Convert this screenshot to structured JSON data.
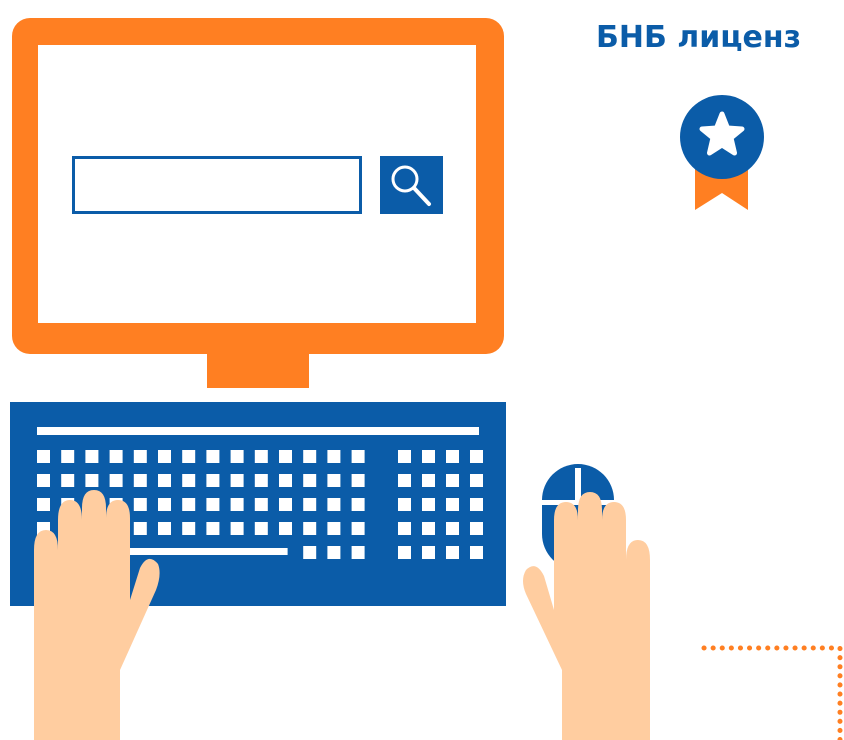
{
  "heading": {
    "text": "БНБ лиценз"
  },
  "search": {
    "value": "",
    "placeholder": ""
  },
  "icons": {
    "search": "search-icon",
    "badge": "badge-star-icon",
    "mouse": "mouse-icon"
  },
  "colors": {
    "orange": "#FF7F22",
    "blue": "#0B5CA8",
    "skin": "#FFCDA0",
    "white": "#FFFFFF"
  }
}
